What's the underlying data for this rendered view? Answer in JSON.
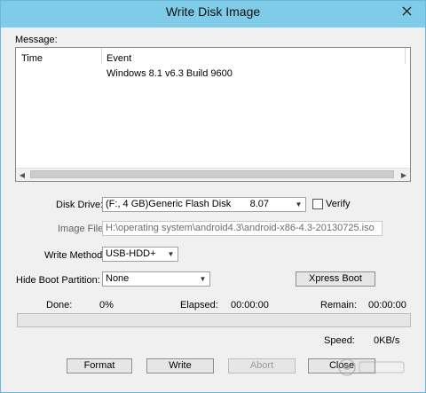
{
  "window": {
    "title": "Write Disk Image"
  },
  "message": {
    "label": "Message:",
    "columns": [
      "Time",
      "Event"
    ],
    "rows": [
      {
        "time": "",
        "event": "Windows 8.1 v6.3 Build 9600"
      }
    ]
  },
  "disk_drive": {
    "label": "Disk Drive:",
    "value": "(F:, 4 GB)Generic Flash Disk       8.07"
  },
  "verify": {
    "label": "Verify",
    "checked": false
  },
  "image_file": {
    "label": "Image File:",
    "value": "H:\\operating system\\android4.3\\android-x86-4.3-20130725.iso"
  },
  "write_method": {
    "label": "Write Method:",
    "value": "USB-HDD+"
  },
  "hide_boot": {
    "label": "Hide Boot Partition:",
    "value": "None"
  },
  "xpress_boot": {
    "label": "Xpress Boot"
  },
  "status": {
    "done_label": "Done:",
    "done_value": "0%",
    "elapsed_label": "Elapsed:",
    "elapsed_value": "00:00:00",
    "remain_label": "Remain:",
    "remain_value": "00:00:00",
    "speed_label": "Speed:",
    "speed_value": "0KB/s",
    "progress": 0
  },
  "buttons": {
    "format": "Format",
    "write": "Write",
    "abort": "Abort",
    "close": "Close"
  },
  "colors": {
    "titlebar": "#7fcbe8",
    "dialog_bg": "#f0f0f0",
    "progress_fill": "#06b025"
  }
}
